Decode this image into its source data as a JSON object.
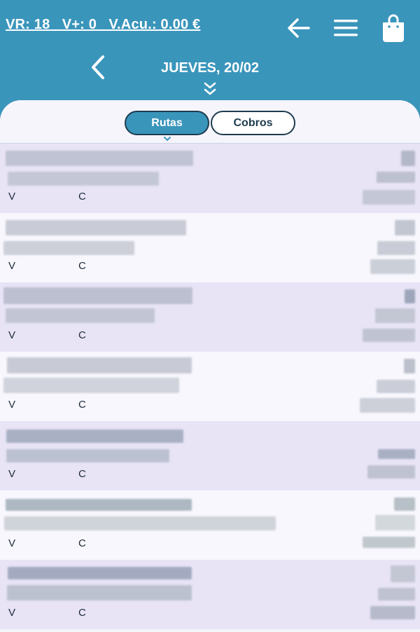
{
  "header": {
    "stats": "VR: 18   V+: 0   V.Acu.: 0.00 €",
    "date": "JUEVES, 20/02",
    "icons": [
      "arrow-left-icon",
      "hamburger-menu-icon",
      "shopping-bag-icon",
      "chevron-left-icon",
      "double-chevron-down-icon"
    ]
  },
  "tabs": {
    "rutas": "Rutas",
    "cobros": "Cobros",
    "active": "Rutas"
  },
  "list": {
    "v_label": "V",
    "c_label": "C",
    "rows": 7
  },
  "colors": {
    "brand": "#3a95bb",
    "row_odd": "#e8e4f6",
    "row_even": "#f8f7fd",
    "tab_border": "#1d3b4e"
  }
}
